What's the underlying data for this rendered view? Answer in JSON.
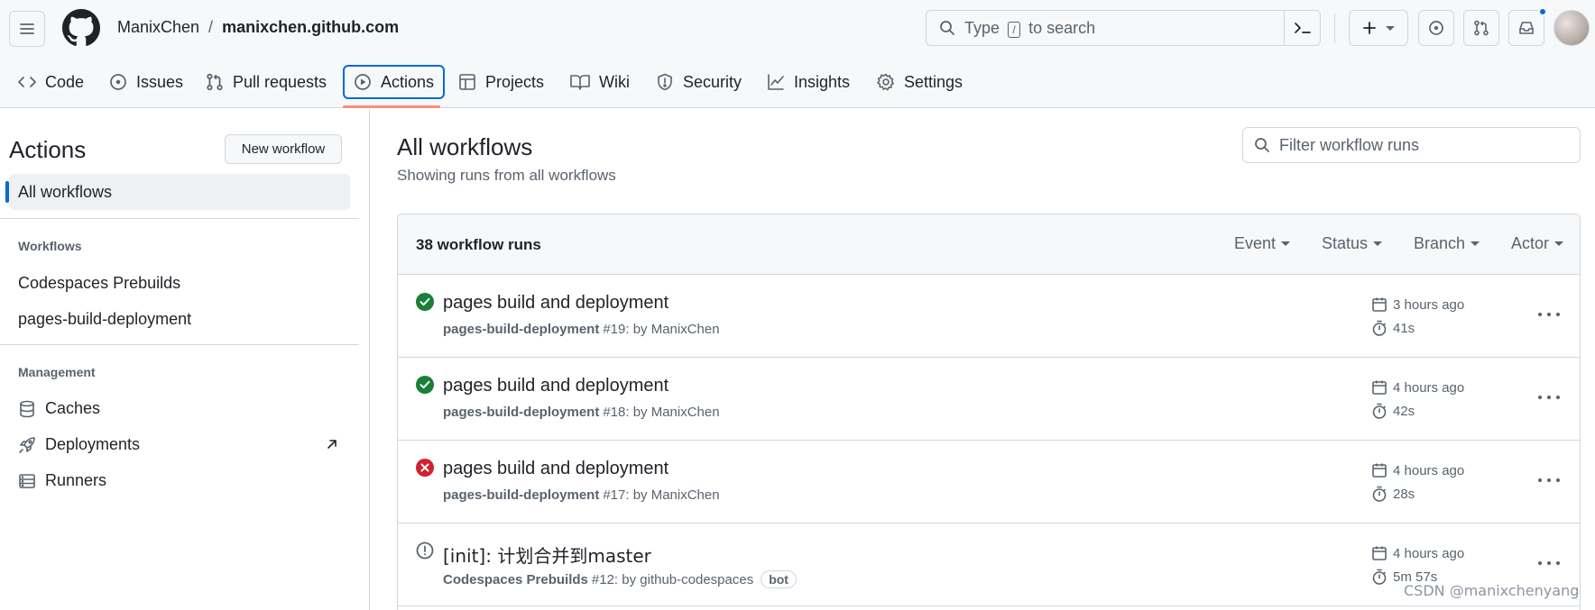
{
  "header": {
    "owner": "ManixChen",
    "separator": "/",
    "repo": "manixchen.github.com",
    "search_prefix": "Type",
    "search_key": "/",
    "search_suffix": "to search"
  },
  "tabs": [
    {
      "label": "Code",
      "icon": "code-icon"
    },
    {
      "label": "Issues",
      "icon": "issue-icon"
    },
    {
      "label": "Pull requests",
      "icon": "pull-request-icon"
    },
    {
      "label": "Actions",
      "icon": "play-icon",
      "active": true
    },
    {
      "label": "Projects",
      "icon": "table-icon"
    },
    {
      "label": "Wiki",
      "icon": "book-icon"
    },
    {
      "label": "Security",
      "icon": "shield-icon"
    },
    {
      "label": "Insights",
      "icon": "graph-icon"
    },
    {
      "label": "Settings",
      "icon": "gear-icon"
    }
  ],
  "sidebar": {
    "title": "Actions",
    "new_workflow": "New workflow",
    "all_workflows": "All workflows",
    "workflows_heading": "Workflows",
    "workflows": [
      "Codespaces Prebuilds",
      "pages-build-deployment"
    ],
    "management_heading": "Management",
    "management": [
      {
        "label": "Caches",
        "icon": "database-icon"
      },
      {
        "label": "Deployments",
        "icon": "rocket-icon"
      },
      {
        "label": "Runners",
        "icon": "server-icon"
      }
    ]
  },
  "main": {
    "title": "All workflows",
    "subtitle": "Showing runs from all workflows",
    "filter_placeholder": "Filter workflow runs",
    "runs_count": "38 workflow runs",
    "filters": [
      "Event",
      "Status",
      "Branch",
      "Actor"
    ],
    "runs": [
      {
        "status": "success",
        "title": "pages build and deployment",
        "workflow": "pages-build-deployment",
        "detail": "#19: by ManixChen",
        "time": "3 hours ago",
        "duration": "41s"
      },
      {
        "status": "success",
        "title": "pages build and deployment",
        "workflow": "pages-build-deployment",
        "detail": "#18: by ManixChen",
        "time": "4 hours ago",
        "duration": "42s"
      },
      {
        "status": "failure",
        "title": "pages build and deployment",
        "workflow": "pages-build-deployment",
        "detail": "#17: by ManixChen",
        "time": "4 hours ago",
        "duration": "28s"
      },
      {
        "status": "neutral",
        "title": "[init]: 计划合并到master",
        "workflow": "Codespaces Prebuilds",
        "detail": "#12: by github-codespaces",
        "badge": "bot",
        "time": "4 hours ago",
        "duration": "5m 57s"
      }
    ]
  },
  "colors": {
    "accent": "#0969da",
    "success": "#1a7f37",
    "failure": "#cf222e",
    "tab_underline": "#fd8c73"
  },
  "watermark": "CSDN @manixchenyang"
}
